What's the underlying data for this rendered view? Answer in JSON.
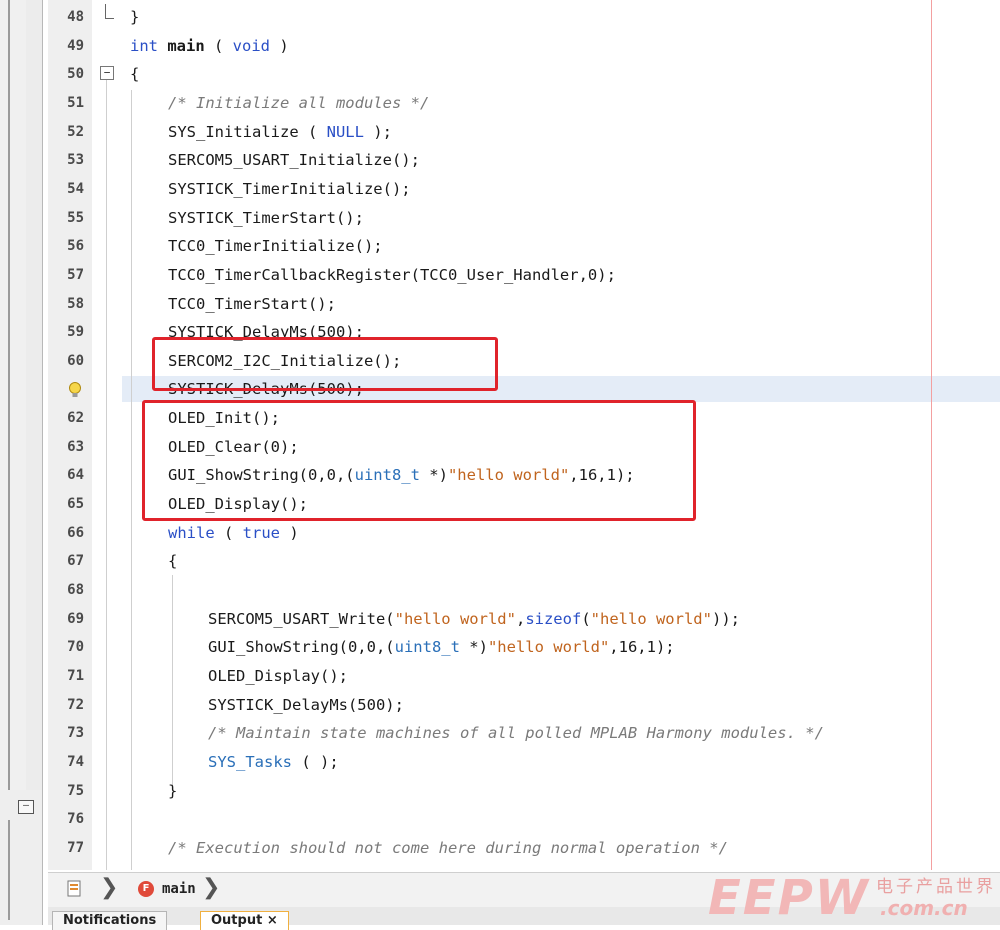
{
  "editor": {
    "lines": [
      {
        "no": "48",
        "indent": 0,
        "tokens": [
          {
            "t": "}",
            "c": ""
          }
        ]
      },
      {
        "no": "49",
        "indent": 0,
        "tokens": [
          {
            "t": "int",
            "c": "kw"
          },
          {
            "t": " ",
            "c": ""
          },
          {
            "t": "main",
            "c": "kwb"
          },
          {
            "t": " ( ",
            "c": ""
          },
          {
            "t": "void",
            "c": "kw"
          },
          {
            "t": " )",
            "c": ""
          }
        ]
      },
      {
        "no": "50",
        "indent": 0,
        "tokens": [
          {
            "t": "{",
            "c": ""
          }
        ]
      },
      {
        "no": "51",
        "indent": 1,
        "tokens": [
          {
            "t": "/* Initialize all modules */",
            "c": "cm"
          }
        ]
      },
      {
        "no": "52",
        "indent": 1,
        "tokens": [
          {
            "t": "SYS_Initialize ( ",
            "c": ""
          },
          {
            "t": "NULL",
            "c": "blue"
          },
          {
            "t": " );",
            "c": ""
          }
        ]
      },
      {
        "no": "53",
        "indent": 1,
        "tokens": [
          {
            "t": "SERCOM5_USART_Initialize();",
            "c": ""
          }
        ]
      },
      {
        "no": "54",
        "indent": 1,
        "tokens": [
          {
            "t": "SYSTICK_TimerInitialize();",
            "c": ""
          }
        ]
      },
      {
        "no": "55",
        "indent": 1,
        "tokens": [
          {
            "t": "SYSTICK_TimerStart();",
            "c": ""
          }
        ]
      },
      {
        "no": "56",
        "indent": 1,
        "tokens": [
          {
            "t": "TCC0_TimerInitialize();",
            "c": ""
          }
        ]
      },
      {
        "no": "57",
        "indent": 1,
        "tokens": [
          {
            "t": "TCC0_TimerCallbackRegister(TCC0_User_Handler,0);",
            "c": ""
          }
        ]
      },
      {
        "no": "58",
        "indent": 1,
        "tokens": [
          {
            "t": "TCC0_TimerStart();",
            "c": ""
          }
        ]
      },
      {
        "no": "59",
        "indent": 1,
        "tokens": [
          {
            "t": "SYSTICK_DelayMs(500);",
            "c": ""
          }
        ]
      },
      {
        "no": "60",
        "indent": 1,
        "tokens": [
          {
            "t": "SERCOM2_I2C_Initialize();",
            "c": ""
          }
        ]
      },
      {
        "no": "",
        "indent": 1,
        "tokens": [
          {
            "t": "SYSTICK_DelayMs(500);",
            "c": ""
          }
        ]
      },
      {
        "no": "62",
        "indent": 1,
        "tokens": [
          {
            "t": "OLED_Init();",
            "c": ""
          }
        ]
      },
      {
        "no": "63",
        "indent": 1,
        "tokens": [
          {
            "t": "OLED_Clear(0);",
            "c": ""
          }
        ]
      },
      {
        "no": "64",
        "indent": 1,
        "tokens": [
          {
            "t": "GUI_ShowString(0,0,(",
            "c": ""
          },
          {
            "t": "uint8_t",
            "c": "typ"
          },
          {
            "t": " *)",
            "c": ""
          },
          {
            "t": "\"hello world\"",
            "c": "str"
          },
          {
            "t": ",16,1);",
            "c": ""
          }
        ]
      },
      {
        "no": "65",
        "indent": 1,
        "tokens": [
          {
            "t": "OLED_Display();",
            "c": ""
          }
        ]
      },
      {
        "no": "66",
        "indent": 1,
        "tokens": [
          {
            "t": "while",
            "c": "kw"
          },
          {
            "t": " ( ",
            "c": ""
          },
          {
            "t": "true",
            "c": "kw"
          },
          {
            "t": " )",
            "c": ""
          }
        ]
      },
      {
        "no": "67",
        "indent": 1,
        "tokens": [
          {
            "t": "{",
            "c": ""
          }
        ]
      },
      {
        "no": "68",
        "indent": 1,
        "tokens": []
      },
      {
        "no": "69",
        "indent": 2,
        "tokens": [
          {
            "t": "SERCOM5_USART_Write(",
            "c": ""
          },
          {
            "t": "\"hello world\"",
            "c": "str"
          },
          {
            "t": ",",
            "c": ""
          },
          {
            "t": "sizeof",
            "c": "kw"
          },
          {
            "t": "(",
            "c": ""
          },
          {
            "t": "\"hello world\"",
            "c": "str"
          },
          {
            "t": "));",
            "c": ""
          }
        ]
      },
      {
        "no": "70",
        "indent": 2,
        "tokens": [
          {
            "t": "GUI_ShowString(0,0,(",
            "c": ""
          },
          {
            "t": "uint8_t",
            "c": "typ"
          },
          {
            "t": " *)",
            "c": ""
          },
          {
            "t": "\"hello world\"",
            "c": "str"
          },
          {
            "t": ",16,1);",
            "c": ""
          }
        ]
      },
      {
        "no": "71",
        "indent": 2,
        "tokens": [
          {
            "t": "OLED_Display();",
            "c": ""
          }
        ]
      },
      {
        "no": "72",
        "indent": 2,
        "tokens": [
          {
            "t": "SYSTICK_DelayMs(500);",
            "c": ""
          }
        ]
      },
      {
        "no": "73",
        "indent": 2,
        "tokens": [
          {
            "t": "/* Maintain state machines of all polled MPLAB Harmony modules. */",
            "c": "cm"
          }
        ]
      },
      {
        "no": "74",
        "indent": 2,
        "tokens": [
          {
            "t": "SYS_Tasks",
            "c": "fn-blue"
          },
          {
            "t": " ( );",
            "c": ""
          }
        ]
      },
      {
        "no": "75",
        "indent": 1,
        "tokens": [
          {
            "t": "}",
            "c": ""
          }
        ]
      },
      {
        "no": "76",
        "indent": 1,
        "tokens": []
      },
      {
        "no": "77",
        "indent": 1,
        "tokens": [
          {
            "t": "/* Execution should not come here during normal operation */",
            "c": "cm"
          }
        ]
      }
    ]
  },
  "breadcrumb": {
    "function_badge": "F",
    "function_name": "main"
  },
  "bottom_tabs": {
    "notifications": "Notifications",
    "output": "Output ×"
  },
  "watermark": {
    "brand": "EEPW",
    "chinese": "电子产品世界",
    "domain": ".com.cn"
  }
}
